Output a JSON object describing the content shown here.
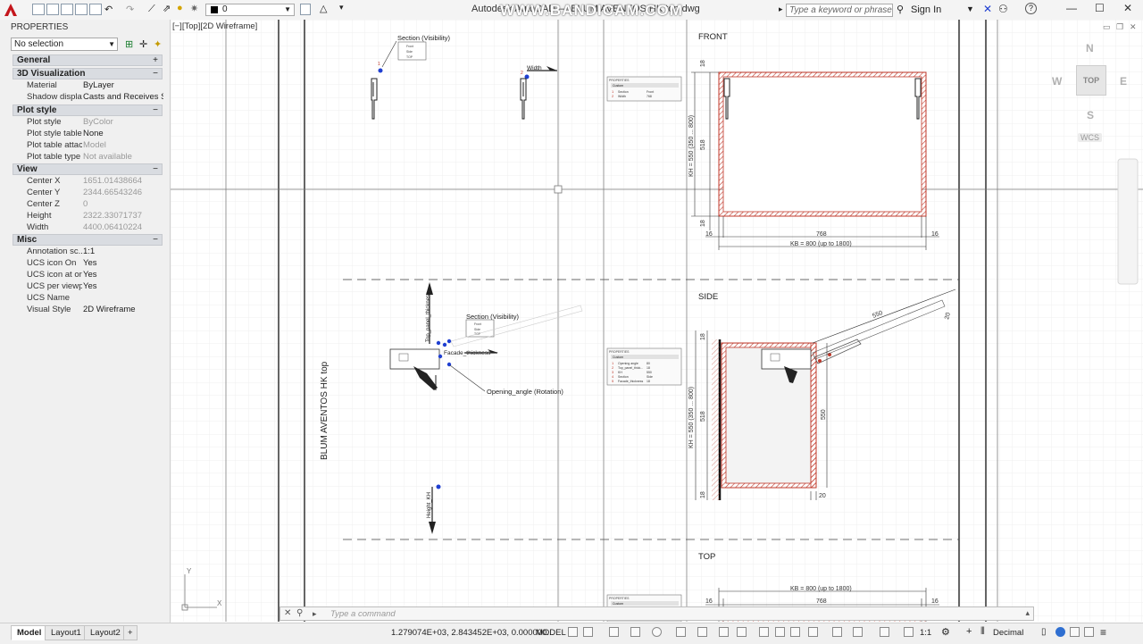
{
  "titlebar": {
    "title": "Autodesk AutoCAD — BLUM AVENTOS HK top.dwg",
    "watermark": "WWW.BANDICAM.COM",
    "layer": "0",
    "search_placeholder": "Type a keyword or phrase",
    "signin": "Sign In",
    "minimize": "—",
    "maximize": "☐",
    "close": "✕"
  },
  "properties": {
    "palette_title": "PROPERTIES",
    "selection": "No selection",
    "groups": [
      {
        "label": "General",
        "toggle": "+"
      },
      {
        "label": "3D Visualization",
        "toggle": "−"
      },
      {
        "label": "Plot style",
        "toggle": "−"
      },
      {
        "label": "View",
        "toggle": "−"
      },
      {
        "label": "Misc",
        "toggle": "−"
      }
    ],
    "visualization": [
      {
        "k": "Material",
        "v": "ByLayer"
      },
      {
        "k": "Shadow display",
        "v": "Casts and Receives Sh..."
      }
    ],
    "plot_style": [
      {
        "k": "Plot style",
        "v": "ByColor"
      },
      {
        "k": "Plot style table",
        "v": "None"
      },
      {
        "k": "Plot table attac...",
        "v": "Model"
      },
      {
        "k": "Plot table type",
        "v": "Not available"
      }
    ],
    "view": [
      {
        "k": "Center X",
        "v": "1651.01438664"
      },
      {
        "k": "Center Y",
        "v": "2344.66543246"
      },
      {
        "k": "Center Z",
        "v": "0"
      },
      {
        "k": "Height",
        "v": "2322.33071737"
      },
      {
        "k": "Width",
        "v": "4400.06410224"
      }
    ],
    "misc": [
      {
        "k": "Annotation sc...",
        "v": "1:1"
      },
      {
        "k": "UCS icon On",
        "v": "Yes"
      },
      {
        "k": "UCS icon at or...",
        "v": "Yes"
      },
      {
        "k": "UCS per viewp...",
        "v": "Yes"
      },
      {
        "k": "UCS Name",
        "v": ""
      },
      {
        "k": "Visual Style",
        "v": "2D Wireframe"
      }
    ]
  },
  "viewport": {
    "label": "[−][Top][2D Wireframe]"
  },
  "viewcube": {
    "north": "N",
    "south": "S",
    "east": "E",
    "west": "W",
    "top": "TOP",
    "wcs": "WCS"
  },
  "drawing": {
    "block_title": "BLUM AVENTOS HK top",
    "view_front": "FRONT",
    "view_side": "SIDE",
    "view_top": "TOP",
    "section_visibility": "Section (Visibility)",
    "width_label": "Width",
    "top_panel_thickness": "Top_panel_thickness",
    "facade_thickness": "Facade_thickness",
    "opening_angle": "Opening_angle (Rotation)",
    "height_kh": "Height_KH",
    "kb_label": "KB = 800 (up to 1800)",
    "kh_label": "KH = 550 (350 ... 800)",
    "dim_768": "768",
    "dim_16": "16",
    "dim_18": "18",
    "dim_518": "518",
    "dim_550": "550",
    "dim_20": "20",
    "vis_front": "Front",
    "vis_side": "Side",
    "vis_top": "TOP",
    "props_caption": "PROPERTIES",
    "props_custom": "Custom",
    "props_front": [
      {
        "n": "1",
        "k": "Section",
        "v": "Front"
      },
      {
        "n": "2",
        "k": "Width",
        "v": "768"
      }
    ],
    "props_side": [
      {
        "n": "1",
        "k": "Opening angle",
        "v": "80"
      },
      {
        "n": "2",
        "k": "Top_panel_thick...",
        "v": "18"
      },
      {
        "n": "3",
        "k": "KH",
        "v": "550"
      },
      {
        "n": "4",
        "k": "Section",
        "v": "Side"
      },
      {
        "n": "5",
        "k": "Facade_thickness",
        "v": "18"
      }
    ],
    "grip_1": "1",
    "grip_2": "2"
  },
  "commandline": {
    "placeholder": "Type a command"
  },
  "statusbar": {
    "tabs": [
      "Model",
      "Layout1",
      "Layout2"
    ],
    "add_tab": "+",
    "coords": "1.279074E+03, 2.843452E+03, 0.000000...",
    "model": "MODEL",
    "annotation_scale": "1:1",
    "units": "Decimal"
  },
  "colors": {
    "grid_minor": "#eeeeee",
    "grid_major": "#dcdcdc",
    "hatch": "#c0392b",
    "grip": "#1f3fd1",
    "dimension": "#333333"
  }
}
